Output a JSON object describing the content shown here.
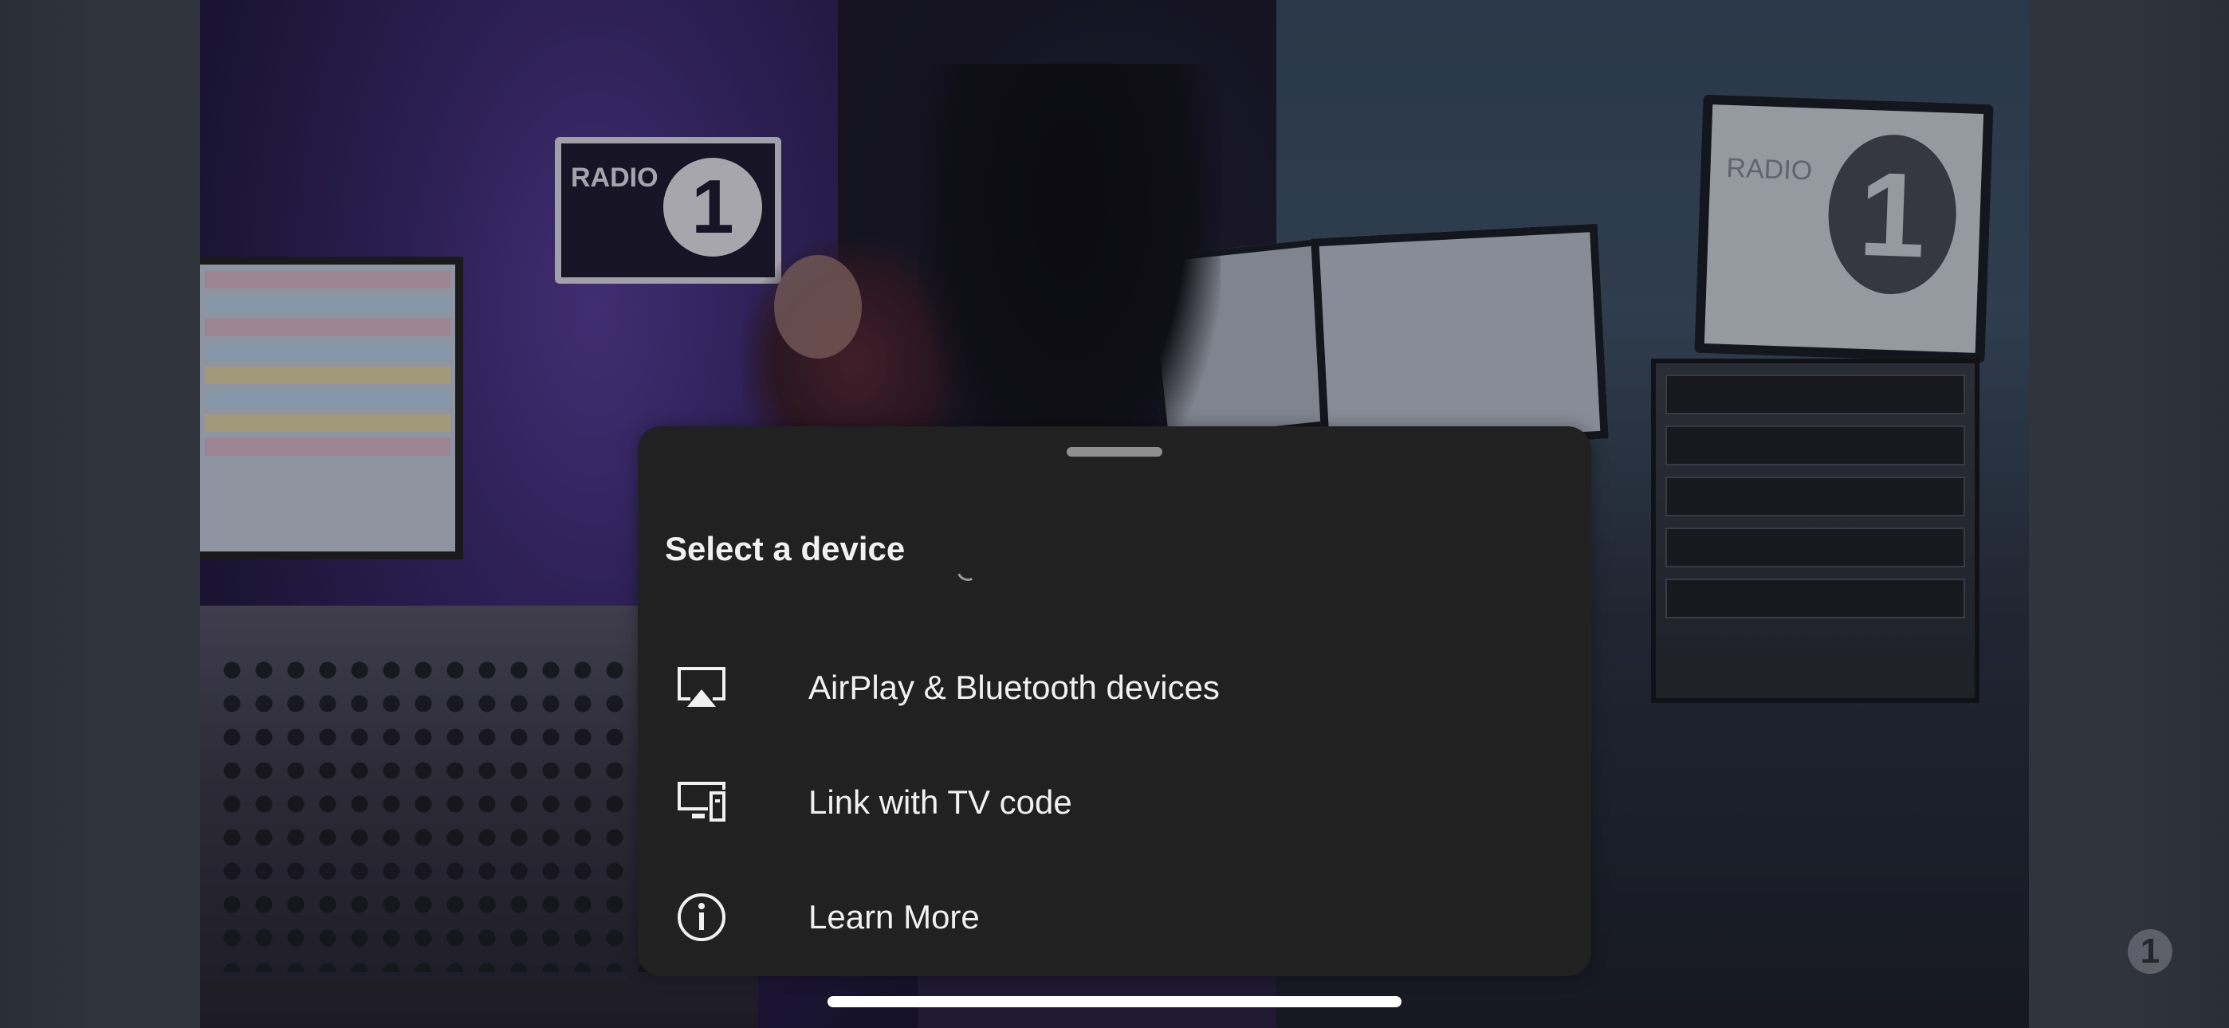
{
  "sheet": {
    "title": "Select a device",
    "items": [
      {
        "icon": "airplay-icon",
        "label": "AirPlay & Bluetooth devices"
      },
      {
        "icon": "tv-link-icon",
        "label": "Link with TV code"
      },
      {
        "icon": "info-icon",
        "label": "Learn More"
      }
    ]
  },
  "video": {
    "sign_text": "RADIO",
    "sign_number": "1",
    "monitor_text": "RADIO",
    "channel_logo": "1"
  },
  "colors": {
    "sheet_background": "#212121",
    "text": "#f1f1f1",
    "handle": "#8f8f8f"
  }
}
